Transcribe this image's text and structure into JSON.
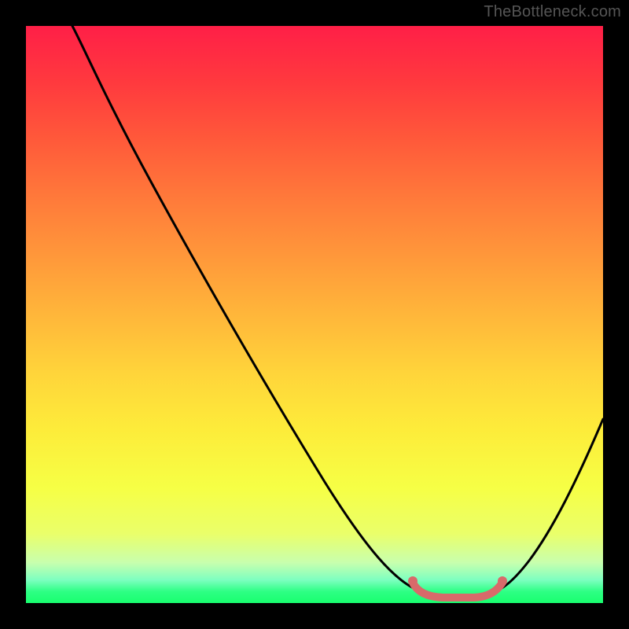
{
  "watermark": "TheBottleneck.com",
  "chart_data": {
    "type": "line",
    "title": "",
    "xlabel": "",
    "ylabel": "",
    "xlim": [
      0,
      100
    ],
    "ylim": [
      0,
      100
    ],
    "series": [
      {
        "name": "bottleneck-curve",
        "x": [
          8,
          12,
          20,
          30,
          40,
          50,
          60,
          65,
          68,
          72,
          78,
          82,
          85,
          90,
          95,
          100
        ],
        "y": [
          100,
          94,
          80,
          63,
          46,
          29,
          12,
          5,
          2,
          1,
          1,
          2,
          5,
          12,
          22,
          33
        ]
      },
      {
        "name": "optimal-range-marker",
        "x": [
          68,
          70,
          74,
          78,
          80,
          82
        ],
        "y": [
          3,
          1.5,
          1,
          1,
          1.5,
          3
        ]
      }
    ],
    "gradient_stops": [
      {
        "pos": 0,
        "color": "#ff1f47"
      },
      {
        "pos": 50,
        "color": "#ffb63a"
      },
      {
        "pos": 80,
        "color": "#f6ff45"
      },
      {
        "pos": 100,
        "color": "#18ff6f"
      }
    ]
  }
}
